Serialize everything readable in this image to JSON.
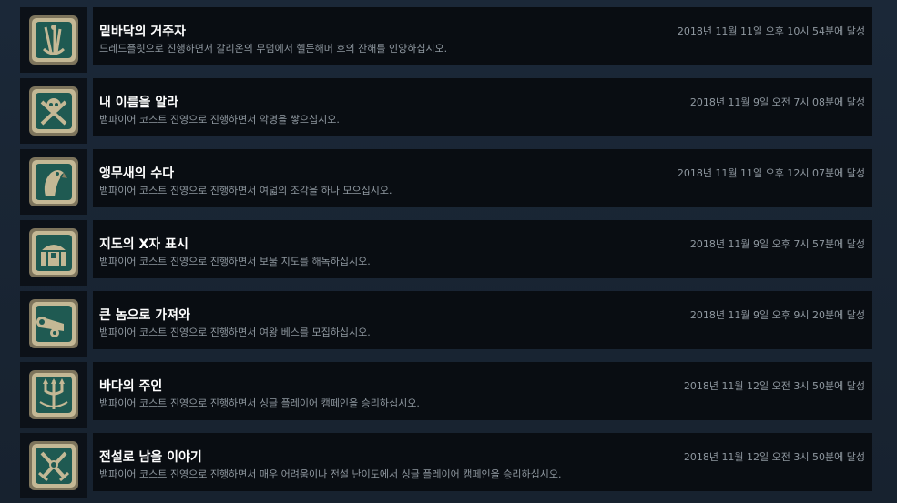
{
  "achievements": [
    {
      "title": "밑바닥의 거주자",
      "description": "드레드플릿으로 진행하면서 갈리온의 무덤에서 헬든해머 호의 잔해를 인양하십시오.",
      "unlocked": "2018년 11월 11일 오후 10시 54분에 달성",
      "icon": "wreck-anchor-icon"
    },
    {
      "title": "내 이름을 알라",
      "description": "뱀파이어 코스트 진영으로 진행하면서 악명을 쌓으십시오.",
      "unlocked": "2018년 11월 9일 오전 7시 08분에 달성",
      "icon": "skull-crossbones-icon"
    },
    {
      "title": "앵무새의 수다",
      "description": "뱀파이어 코스트 진영으로 진행하면서 여덟의 조각을 하나 모으십시오.",
      "unlocked": "2018년 11월 11일 오후 12시 07분에 달성",
      "icon": "parrot-icon"
    },
    {
      "title": "지도의 X자 표시",
      "description": "뱀파이어 코스트 진영으로 진행하면서 보물 지도를 해독하십시오.",
      "unlocked": "2018년 11월 9일 오후 7시 57분에 달성",
      "icon": "treasure-chest-icon"
    },
    {
      "title": "큰 놈으로 가져와",
      "description": "뱀파이어 코스트 진영으로 진행하면서 여왕 베스를 모집하십시오.",
      "unlocked": "2018년 11월 9일 오후 9시 20분에 달성",
      "icon": "cannon-icon"
    },
    {
      "title": "바다의 주인",
      "description": "뱀파이어 코스트 진영으로 진행하면서 싱글 플레이어 캠페인을 승리하십시오.",
      "unlocked": "2018년 11월 12일 오전 3시 50분에 달성",
      "icon": "trident-icon"
    },
    {
      "title": "전설로 남을 이야기",
      "description": "뱀파이어 코스트 진영으로 진행하면서 매우 어려움이나 전설 난이도에서 싱글 플레이어 캠페인을 승리하십시오.",
      "unlocked": "2018년 11월 12일 오전 3시 50분에 달성",
      "icon": "crossed-swords-icon"
    }
  ],
  "colors": {
    "background": "#1b2838",
    "panel": "#090d12",
    "title": "#ffffff",
    "secondary_text": "#8f98a0",
    "icon_teal": "#1f5a52",
    "icon_bronze": "#b8ab8a"
  }
}
